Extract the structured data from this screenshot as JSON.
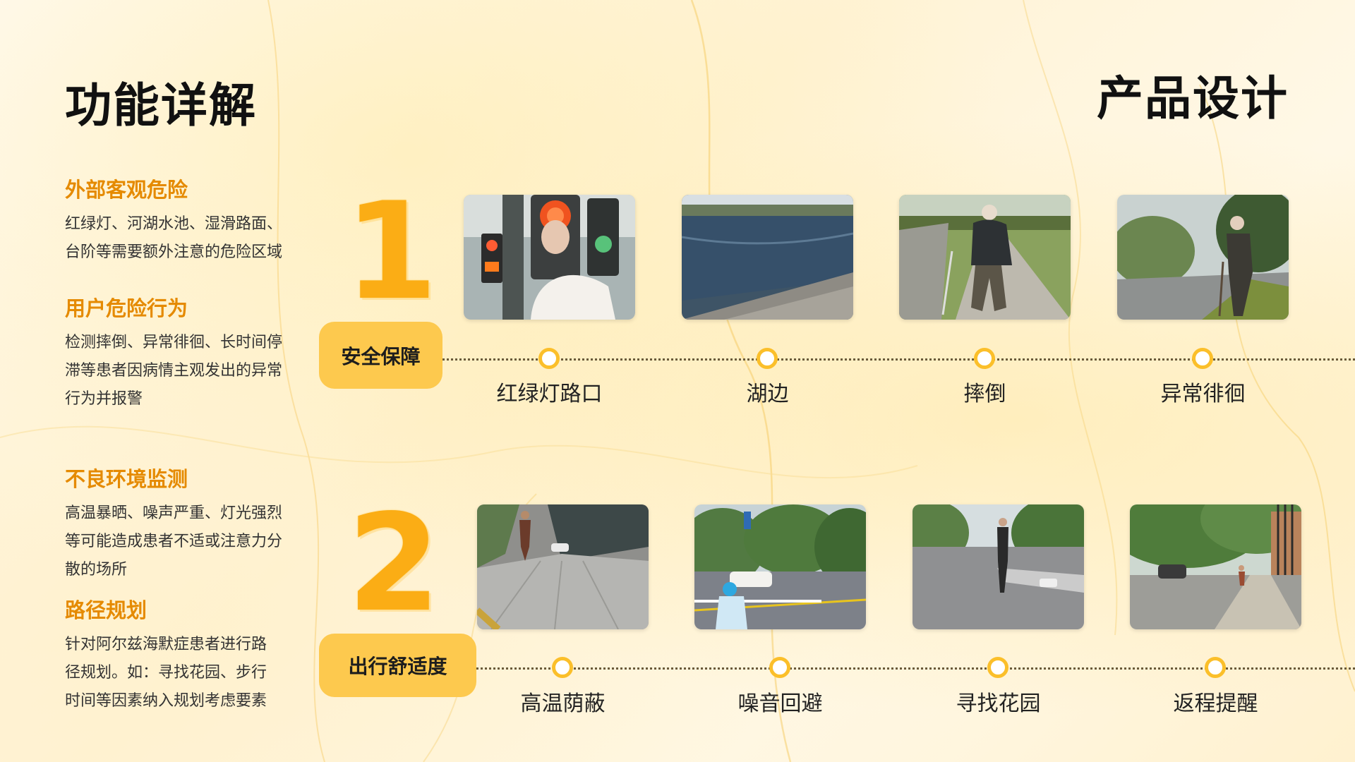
{
  "slide_title": "功能详解",
  "section_title": "产品设计",
  "left_panel": [
    {
      "heading": "外部客观危险",
      "text_lines": [
        "红绿灯、河湖水池、湿滑路面、",
        "台阶等需要额外注意的危险区域"
      ]
    },
    {
      "heading": "用户危险行为",
      "text_lines": [
        "检测摔倒、异常徘徊、长时间停",
        "滞等患者因病情主观发出的异常",
        "行为并报警"
      ]
    },
    {
      "heading": "不良环境监测",
      "text_lines": [
        "高温暴晒、噪声严重、灯光强烈",
        "等可能造成患者不适或注意力分",
        "散的场所"
      ]
    },
    {
      "heading": "路径规划",
      "text_lines": [
        "针对阿尔兹海默症患者进行路",
        "径规划。如：寻找花园、步行",
        "时间等因素纳入规划考虑要素"
      ]
    }
  ],
  "rows": [
    {
      "number": "1",
      "category": "安全保障",
      "items": [
        {
          "caption": "红绿灯路口",
          "image": "traffic-light-elder-photo"
        },
        {
          "caption": "湖边",
          "image": "lakeside-photo"
        },
        {
          "caption": "摔倒",
          "image": "elder-with-cane-walking-photo"
        },
        {
          "caption": "异常徘徊",
          "image": "elder-wandering-roadside-photo"
        }
      ]
    },
    {
      "number": "2",
      "category": "出行舒适度",
      "items": [
        {
          "caption": "高温荫蔽",
          "image": "shaded-sidewalk-robot-dog-photo"
        },
        {
          "caption": "噪音回避",
          "image": "busy-street-scooter-photo"
        },
        {
          "caption": "寻找花园",
          "image": "crosswalk-park-photo"
        },
        {
          "caption": "返程提醒",
          "image": "tree-lined-street-photo"
        }
      ]
    }
  ],
  "colors": {
    "accent": "#fbad15",
    "heading": "#e58a00",
    "pill": "#fdc94e",
    "dot_ring": "#fbbf2a"
  }
}
